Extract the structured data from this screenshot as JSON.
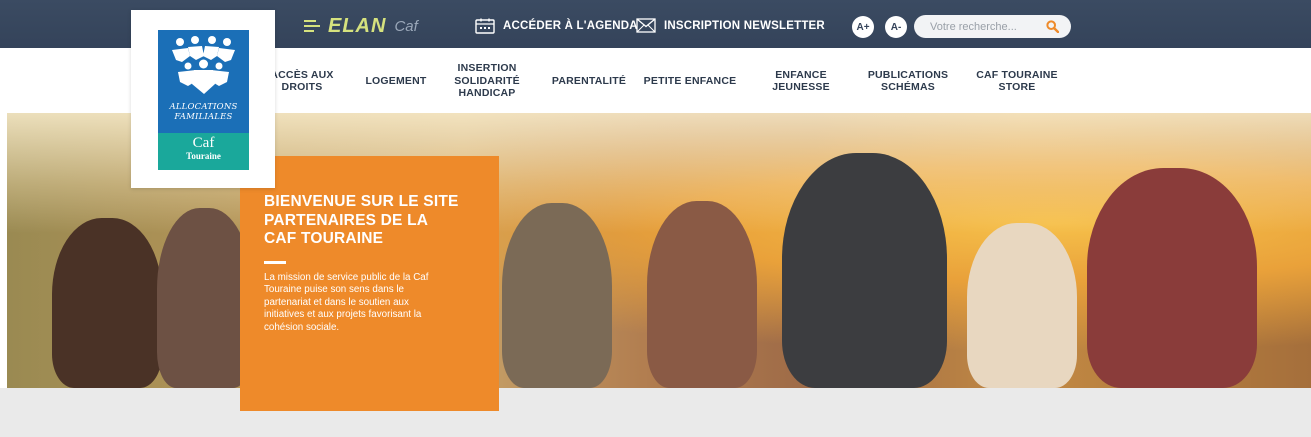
{
  "brand": {
    "elan_word": "ELAN",
    "elan_caf": "Caf",
    "accent": "#d6e27e",
    "topbar_color": "#34435a"
  },
  "topbar": {
    "agenda_label": "ACCÉDER À L'AGENDA",
    "newsletter_label": "INSCRIPTION NEWSLETTER",
    "font_increase": "A+",
    "font_decrease": "A-",
    "search_placeholder": "Votre recherche...",
    "icons": [
      "calendar-icon",
      "envelope-icon",
      "search-icon"
    ]
  },
  "logo": {
    "line1": "ALLOCATIONS",
    "line2": "FAMILIALES",
    "caf": "Caf",
    "touraine": "Touraine",
    "blue": "#1b6fb7",
    "teal": "#1aa89b"
  },
  "nav": {
    "items": [
      {
        "line1": "ACCÈS AUX",
        "line2": "DROITS",
        "line3": ""
      },
      {
        "line1": "LOGEMENT",
        "line2": "",
        "line3": ""
      },
      {
        "line1": "INSERTION",
        "line2": "SOLIDARITÉ",
        "line3": "HANDICAP"
      },
      {
        "line1": "PARENTALITÉ",
        "line2": "",
        "line3": ""
      },
      {
        "line1": "PETITE ENFANCE",
        "line2": "",
        "line3": ""
      },
      {
        "line1": "ENFANCE",
        "line2": "JEUNESSE",
        "line3": ""
      },
      {
        "line1": "PUBLICATIONS",
        "line2": "SCHÉMAS",
        "line3": ""
      },
      {
        "line1": "CAF TOURAINE",
        "line2": "STORE",
        "line3": ""
      }
    ]
  },
  "hero": {
    "title_line1": "BIENVENUE SUR LE SITE",
    "title_line2": "PARTENAIRES DE LA",
    "title_line3": "CAF TOURAINE",
    "text_line1": "La mission de service public de la Caf",
    "text_line2": "Touraine puise son sens dans le",
    "text_line3": "partenariat et dans le soutien aux",
    "text_line4": "initiatives et aux projets favorisant la",
    "text_line5": "cohésion sociale.",
    "promo_color": "#ee8a2a"
  }
}
